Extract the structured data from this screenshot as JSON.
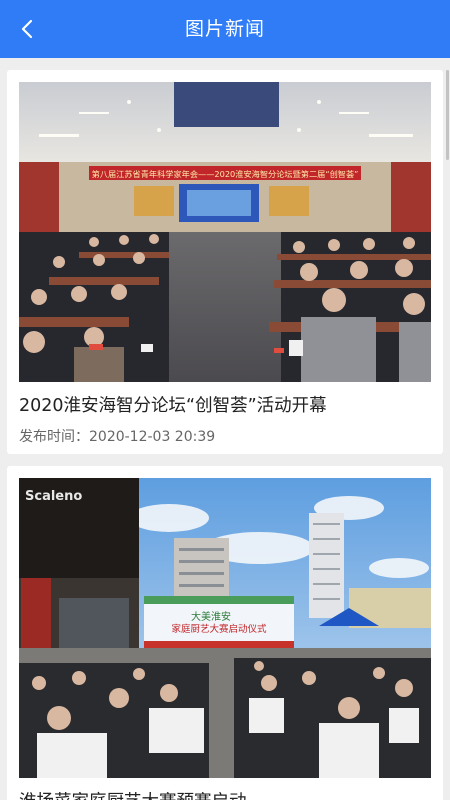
{
  "header": {
    "title": "图片新闻",
    "back_icon": "back-chevron-icon",
    "background": "#2f7cf6"
  },
  "news": [
    {
      "title": "2020淮安海智分论坛“创智荟”活动开幕",
      "date_label": "发布时间：",
      "date": "2020-12-03 20:39",
      "banner_text": "第八届江苏省青年科学家年会——2020淮安海智分论坛暨第二届“创智荟”"
    },
    {
      "title": "淮扬菜家庭厨艺大赛预赛启动",
      "board_text": "家庭厨艺大赛启动仪式",
      "board_small": "大美淮安",
      "store_sign": "Scaleno"
    }
  ]
}
